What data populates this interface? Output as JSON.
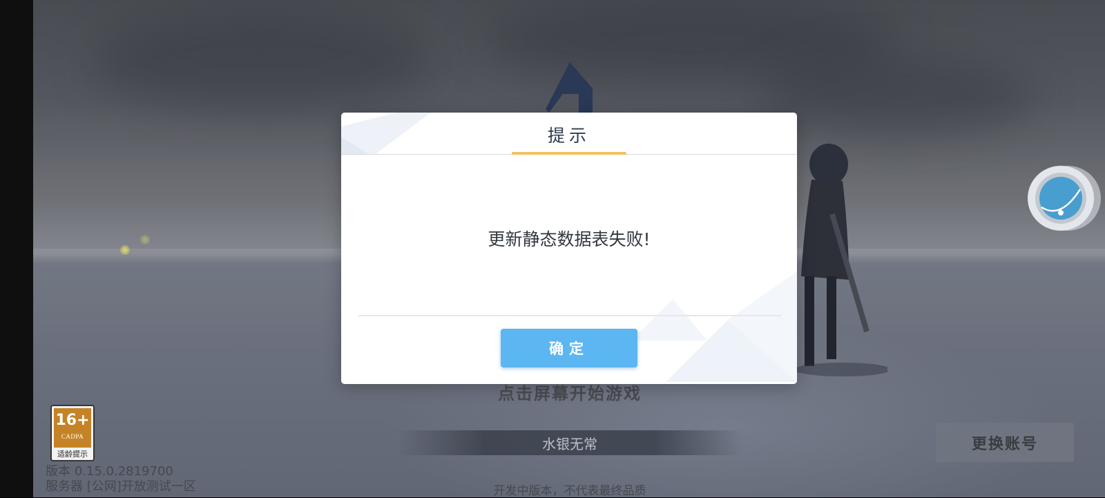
{
  "dialog": {
    "title": "提示",
    "message": "更新静态数据表失败!",
    "ok_label": "确定"
  },
  "background": {
    "tap_to_start": "点击屏幕开始游戏",
    "player_name": "水银无常",
    "switch_account": "更换账号",
    "dev_notice": "开发中版本，不代表最终品质"
  },
  "age_rating": {
    "rating": "16+",
    "org": "CADPA",
    "caption": "适龄提示"
  },
  "info": {
    "version": "版本 0.15.0.2819700",
    "server": "服务器 [公网]开放测试一区"
  },
  "colors": {
    "dialog_button": "#5cb6f2",
    "title_accent": "#f2c162",
    "rating_badge": "#c27c19"
  }
}
